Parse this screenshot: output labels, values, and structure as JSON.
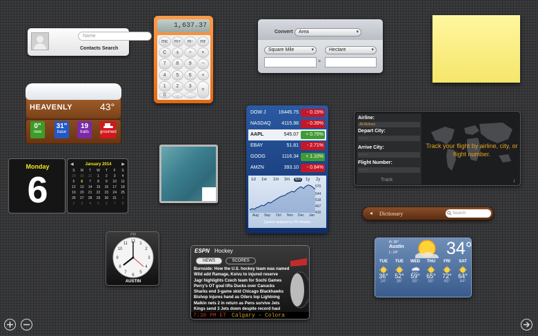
{
  "contacts": {
    "placeholder": "Name",
    "label": "Contacts Search",
    "icon": "person-silhouette-icon"
  },
  "calculator": {
    "display": "1,637.37",
    "keys": [
      "mc",
      "m+",
      "m-",
      "mr",
      "C",
      "±",
      "÷",
      "×",
      "7",
      "8",
      "9",
      "−",
      "4",
      "5",
      "6",
      "+",
      "1",
      "2",
      "3",
      "=",
      "0",
      ".",
      ""
    ]
  },
  "converter": {
    "convert_label": "Convert",
    "category": "Area",
    "from_unit": "Square Mile",
    "to_unit": "Hectare",
    "from_value": "",
    "to_value": "",
    "equals": "="
  },
  "sticky_note": {
    "text": "",
    "color": "#f8ea7e"
  },
  "ski": {
    "resort": "HEAVENLY",
    "temperature": "43°",
    "stats": [
      {
        "value": "0\"",
        "label": "new",
        "color": "#3c9c2a"
      },
      {
        "value": "31\"",
        "label": "base",
        "color": "#2358c8"
      },
      {
        "value": "19",
        "label": "trails",
        "color": "#7a2aa8"
      },
      {
        "value": "",
        "label": "groomed",
        "color": "#d2171d",
        "icon": "snowcat-icon"
      }
    ]
  },
  "stocks": {
    "rows": [
      {
        "symbol": "DOW J",
        "price": "16445.75",
        "change": "- 0.15%",
        "direction": "down"
      },
      {
        "symbol": "NASDAQ",
        "price": "4115.98",
        "change": "- 0.39%",
        "direction": "down"
      },
      {
        "symbol": "AAPL",
        "price": "545.07",
        "change": "+ 0.76%",
        "direction": "up"
      },
      {
        "symbol": "EBAY",
        "price": "51.81",
        "change": "- 2.71%",
        "direction": "down"
      },
      {
        "symbol": "GOOG",
        "price": "1116.34",
        "change": "+ 1.10%",
        "direction": "up"
      },
      {
        "symbol": "AMZN",
        "price": "393.10",
        "change": "- 0.84%",
        "direction": "down"
      }
    ],
    "selected": "AAPL",
    "ranges": [
      "1d",
      "1w",
      "1m",
      "3m",
      "6m",
      "1y",
      "2y"
    ],
    "active_range": "6m",
    "y_ticks": [
      "570",
      "544",
      "518",
      "467",
      "416"
    ],
    "months": [
      "Aug",
      "Sep",
      "Oct",
      "Nov",
      "Dec",
      "Jan"
    ],
    "note": "Quotes delayed by 20 minutes",
    "chart_line": [
      0.1,
      0.14,
      0.12,
      0.18,
      0.2,
      0.26,
      0.24,
      0.3,
      0.36,
      0.34,
      0.4,
      0.45,
      0.5,
      0.55,
      0.58,
      0.6,
      0.66,
      0.7,
      0.74,
      0.72,
      0.8,
      0.86,
      0.9,
      0.84,
      0.92,
      0.96,
      0.94,
      0.88,
      0.82
    ]
  },
  "flight": {
    "airline_label": "Airline:",
    "airline_value": "All Airlines",
    "depart_label": "Depart City:",
    "depart_value": "- - - -",
    "arrive_label": "Arrive City:",
    "arrive_value": "- - - -",
    "flight_label": "Flight Number:",
    "flight_value": "- - - -",
    "track_label": "Track",
    "tagline": "Track your flight by airline, city, or flight number.",
    "info": "i"
  },
  "calendar": {
    "day_name": "Monday",
    "day_number": "6",
    "month_title": "January 2014",
    "weekdays": [
      "S",
      "M",
      "T",
      "W",
      "T",
      "F",
      "S"
    ],
    "days": [
      "29",
      "30",
      "31",
      "1",
      "2",
      "3",
      "4",
      "5",
      "6",
      "7",
      "8",
      "9",
      "10",
      "11",
      "12",
      "13",
      "14",
      "15",
      "16",
      "17",
      "18",
      "19",
      "20",
      "21",
      "22",
      "23",
      "24",
      "25",
      "26",
      "27",
      "28",
      "29",
      "30",
      "31",
      "1",
      "2",
      "3",
      "4",
      "5",
      "6",
      "7",
      "8"
    ],
    "today": "6"
  },
  "dictionary": {
    "label": "Dictionary",
    "search_placeholder": "Search"
  },
  "clock": {
    "ampm": "PM",
    "city": "AUSTIN"
  },
  "espn": {
    "brand": "ESPN",
    "sport": "Hockey",
    "tabs": [
      "NEWS",
      "SCORES"
    ],
    "headlines": [
      "Burnside: How the U.S. hockey team was named",
      "Wild add Ramage, Koivu to injured reserve",
      "Jagr highlights Czech team for Sochi Games",
      "Perry's OT goal lifts Ducks over Canucks",
      "Sharks end 3-game skid Chicago Blackhawks",
      "Bishop injures hand as Oilers top Lightning",
      "Malkin nets 2 in return as Pens survive Jets",
      "Kings send 3 Jets down despite record haul"
    ],
    "ticker_time": "7:30 PM ET",
    "ticker_text": "Calgary - Colora"
  },
  "weather": {
    "high": "H: 36°",
    "city": "Austin",
    "low": "L: 24°",
    "current": "34°",
    "forecast": [
      {
        "day": "TUE",
        "hi": "36°",
        "lo": "24°",
        "icon": "sun-icon"
      },
      {
        "day": "TUE",
        "hi": "52°",
        "lo": "36°",
        "icon": "sun-icon"
      },
      {
        "day": "WED",
        "hi": "59°",
        "lo": "55°",
        "icon": "cloud-rain-icon"
      },
      {
        "day": "THU",
        "hi": "65°",
        "lo": "55°",
        "icon": "sun-icon"
      },
      {
        "day": "FRI",
        "hi": "72°",
        "lo": "45°",
        "icon": "sun-icon"
      },
      {
        "day": "SAT",
        "hi": "64°",
        "lo": "44°",
        "icon": "sun-icon"
      }
    ]
  },
  "controls": {
    "add": "add-widget-icon",
    "remove": "remove-widget-icon",
    "next": "next-arrow-icon"
  }
}
